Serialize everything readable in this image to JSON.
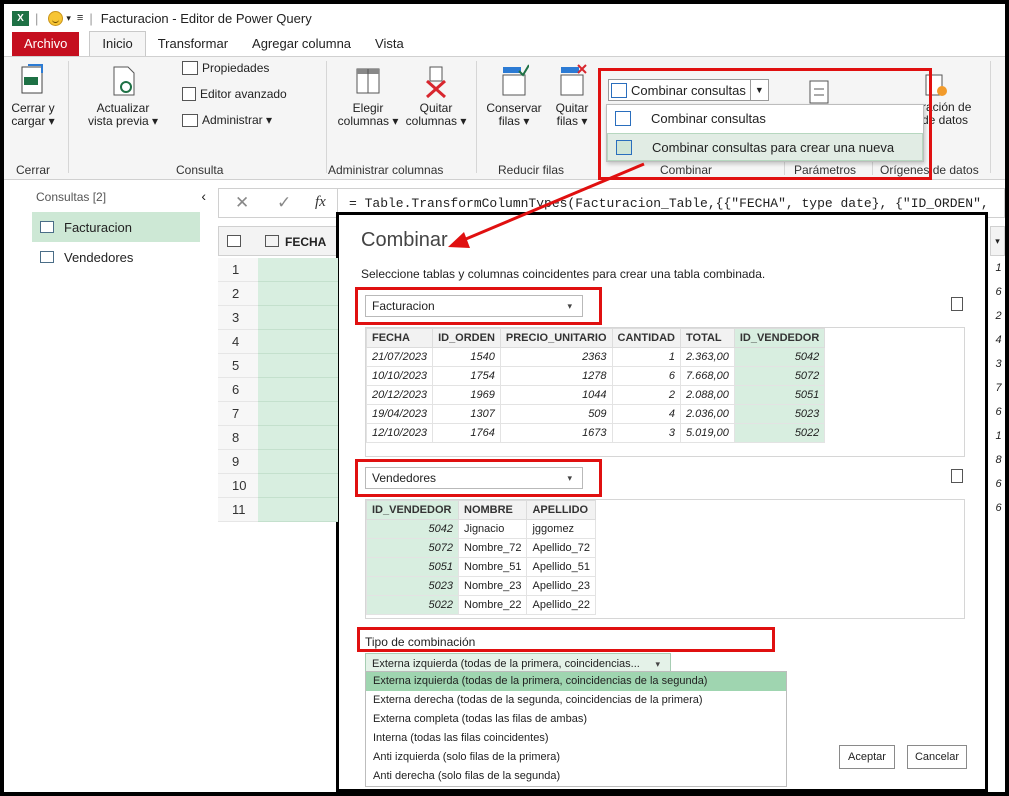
{
  "titlebar": {
    "app_icon": "X",
    "title": "Facturacion - Editor de Power Query"
  },
  "menu": {
    "tabs": [
      "Archivo",
      "Inicio",
      "Transformar",
      "Agregar columna",
      "Vista"
    ]
  },
  "ribbon": {
    "close_btn": "Cerrar y cargar",
    "close_btn_l1": "Cerrar y",
    "close_btn_l2": "cargar ▾",
    "refresh_l1": "Actualizar",
    "refresh_l2": "vista previa ▾",
    "properties": "Propiedades",
    "advanced_editor": "Editor avanzado",
    "manage": "Administrar ▾",
    "choose_cols_l1": "Elegir",
    "choose_cols_l2": "columnas ▾",
    "remove_cols_l1": "Quitar",
    "remove_cols_l2": "columnas ▾",
    "keep_rows_l1": "Conservar",
    "keep_rows_l2": "filas ▾",
    "remove_rows_l1": "Quitar",
    "remove_rows_l2": "filas ▾",
    "combine_queries": "Combinar consultas",
    "config_l1": "ración de",
    "config_l2": "de datos",
    "groups": {
      "cerrar": "Cerrar",
      "consulta": "Consulta",
      "admin_cols": "Administrar columnas",
      "reduce_rows": "Reducir filas",
      "combinar": "Combinar",
      "parametros": "Parámetros",
      "origenes": "Orígenes de datos"
    }
  },
  "combine_menu": {
    "items": [
      "Combinar consultas",
      "Combinar consultas para crear una nueva"
    ]
  },
  "queries": {
    "header": "Consultas [2]",
    "items": [
      "Facturacion",
      "Vendedores"
    ]
  },
  "formula": {
    "fx": "fx",
    "text": "= Table.TransformColumnTypes(Facturacion_Table,{{\"FECHA\", type date}, {\"ID_ORDEN\","
  },
  "grid": {
    "header": "FECHA",
    "row_numbers": [
      "1",
      "2",
      "3",
      "4",
      "5",
      "6",
      "7",
      "8",
      "9",
      "10",
      "11"
    ],
    "right_values": [
      "1",
      "6",
      "2",
      "4",
      "3",
      "7",
      "6",
      "1",
      "8",
      "6",
      "6"
    ]
  },
  "dialog": {
    "title": "Combinar",
    "description": "Seleccione tablas y columnas coincidentes para crear una tabla combinada.",
    "table1": {
      "selected": "Facturacion",
      "columns": [
        "FECHA",
        "ID_ORDEN",
        "PRECIO_UNITARIO",
        "CANTIDAD",
        "TOTAL",
        "ID_VENDEDOR"
      ],
      "rows": [
        [
          "21/07/2023",
          "1540",
          "2363",
          "1",
          "2.363,00",
          "5042"
        ],
        [
          "10/10/2023",
          "1754",
          "1278",
          "6",
          "7.668,00",
          "5072"
        ],
        [
          "20/12/2023",
          "1969",
          "1044",
          "2",
          "2.088,00",
          "5051"
        ],
        [
          "19/04/2023",
          "1307",
          "509",
          "4",
          "2.036,00",
          "5023"
        ],
        [
          "12/10/2023",
          "1764",
          "1673",
          "3",
          "5.019,00",
          "5022"
        ]
      ]
    },
    "table2": {
      "selected": "Vendedores",
      "columns": [
        "ID_VENDEDOR",
        "NOMBRE",
        "APELLIDO"
      ],
      "rows": [
        [
          "5042",
          "Jignacio",
          "jggomez"
        ],
        [
          "5072",
          "Nombre_72",
          "Apellido_72"
        ],
        [
          "5051",
          "Nombre_51",
          "Apellido_51"
        ],
        [
          "5023",
          "Nombre_23",
          "Apellido_23"
        ],
        [
          "5022",
          "Nombre_22",
          "Apellido_22"
        ]
      ]
    },
    "join_label": "Tipo de combinación",
    "join_selected": "Externa izquierda (todas de la primera, coincidencias...",
    "join_options": [
      "Externa izquierda (todas de la primera, coincidencias de la segunda)",
      "Externa derecha (todas de la segunda, coincidencias de la primera)",
      "Externa completa (todas las filas de ambas)",
      "Interna (todas las filas coincidentes)",
      "Anti izquierda (solo filas de la primera)",
      "Anti derecha (solo filas de la segunda)"
    ],
    "ok": "Aceptar",
    "cancel": "Cancelar"
  },
  "colors": {
    "accent_green": "#d8eee0",
    "highlight": "#e01010",
    "file_tab": "#c50f1f"
  }
}
